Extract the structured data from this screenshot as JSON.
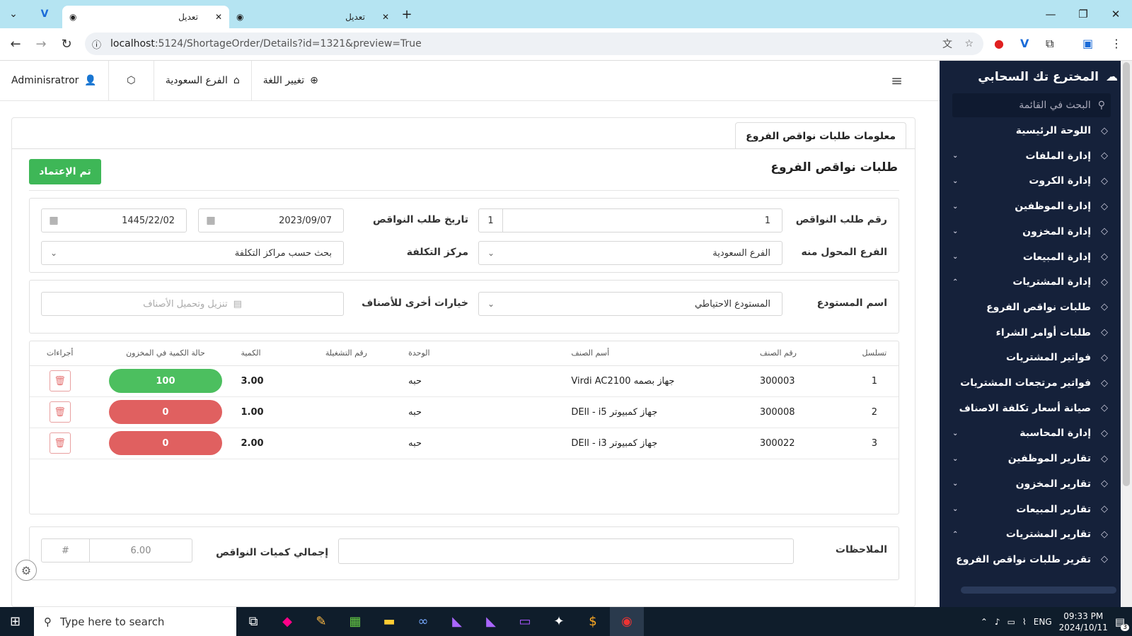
{
  "browser": {
    "tabs": [
      {
        "title": "تعديل",
        "active": true
      },
      {
        "title": "تعديل",
        "active": false
      }
    ],
    "url_host": "localhost",
    "url_rest": ":5124/ShortageOrder/Details?id=1321&preview=True"
  },
  "topnav": {
    "user": "Adminisratror",
    "branch": "الفرع السعودية",
    "language": "تغيير اللغة"
  },
  "card": {
    "tab_label": "معلومات طلبات نواقص الفروع",
    "page_title": "طلبات نواقص الفروع",
    "approve_label": "تم الإعتماد"
  },
  "form": {
    "order_number_label": "رقم طلب النواقص",
    "order_number_value": "1",
    "order_number_small": "1",
    "order_date_label": "تاريخ طلب النواقص",
    "order_date_value": "2023/09/07",
    "hijri_date_value": "1445/22/02",
    "from_branch_label": "الفرع المحول منه",
    "from_branch_value": "الفرع السعودية",
    "cost_center_label": "مركز التكلفة",
    "cost_center_value": "بحث حسب مراكز التكلفة",
    "warehouse_label": "اسم المستودع",
    "warehouse_value": "المستودع الاحتياطي",
    "other_options_label": "خيارات أخرى للأصناف",
    "download_placeholder": "تنزيل وتحميل الأصناف"
  },
  "table": {
    "headers": {
      "seq": "تسلسل",
      "item_no": "رقم الصنف",
      "item_name": "أسم الصنف",
      "unit": "الوحدة",
      "batch": "رقم التشغيلة",
      "qty": "الكمية",
      "stock_status": "حالة الكمية في المخزون",
      "actions": "أجراءات"
    },
    "rows": [
      {
        "seq": "1",
        "item_no": "300003",
        "item_name": "جهاز بصمه Virdi AC2100",
        "unit": "حبه",
        "batch": "",
        "qty": "3.00",
        "stock": "100",
        "stock_color": "#4cbf5f"
      },
      {
        "seq": "2",
        "item_no": "300008",
        "item_name": "جهاز كمبيوتر DEll - i5",
        "unit": "حبه",
        "batch": "",
        "qty": "1.00",
        "stock": "0",
        "stock_color": "#e06060"
      },
      {
        "seq": "3",
        "item_no": "300022",
        "item_name": "جهاز كمبيوتر DEll - i3",
        "unit": "حبه",
        "batch": "",
        "qty": "2.00",
        "stock": "0",
        "stock_color": "#e06060"
      }
    ]
  },
  "footer": {
    "notes_label": "الملاحظات",
    "total_label": "إجمالي كميات النواقص",
    "total_value": "6.00",
    "hash": "#"
  },
  "sidebar": {
    "brand": "المخترع تك السحابي",
    "search_placeholder": "البحث في القائمة",
    "items": [
      {
        "label": "اللوحة الرئيسية",
        "icon": "home-icon",
        "arrow": ""
      },
      {
        "label": "إدارة الملفات",
        "icon": "file-icon",
        "arrow": "⌄"
      },
      {
        "label": "إدارة الكروت",
        "icon": "tag-icon",
        "arrow": "⌄"
      },
      {
        "label": "إدارة الموظفين",
        "icon": "fingerprint-icon",
        "arrow": "⌄"
      },
      {
        "label": "إدارة المخزون",
        "icon": "box-icon",
        "arrow": "⌄"
      },
      {
        "label": "إدارة المبيعات",
        "icon": "cart-icon",
        "arrow": "⌄"
      },
      {
        "label": "إدارة المشتريات",
        "icon": "basket-icon",
        "arrow": "⌃"
      },
      {
        "label": "طلبات نواقص الفروع",
        "icon": "basket-icon",
        "arrow": "",
        "sub": true
      },
      {
        "label": "طلبات أوامر الشراء",
        "icon": "basket-icon",
        "arrow": "",
        "sub": true
      },
      {
        "label": "فواتير المشتريات",
        "icon": "basket-plus-icon",
        "arrow": "",
        "sub": true
      },
      {
        "label": "فواتير مرتجعات المشتريات",
        "icon": "basket-return-icon",
        "arrow": "",
        "sub": true
      },
      {
        "label": "صيانة أسعار تكلفة الاصناف",
        "icon": "bag-search-icon",
        "arrow": "",
        "sub": true
      },
      {
        "label": "إدارة المحاسبة",
        "icon": "dollar-icon",
        "arrow": "⌄"
      },
      {
        "label": "تقارير الموظفين",
        "icon": "user-search-icon",
        "arrow": "⌄"
      },
      {
        "label": "تقارير المخزون",
        "icon": "report-box-icon",
        "arrow": "⌄"
      },
      {
        "label": "تقارير المبيعات",
        "icon": "report-cart-icon",
        "arrow": "⌄"
      },
      {
        "label": "تقارير المشتريات",
        "icon": "report-basket-icon",
        "arrow": "⌃"
      },
      {
        "label": "تقرير طلبات نواقص الفروع",
        "icon": "report-file-icon",
        "arrow": "",
        "sub": true
      }
    ]
  },
  "taskbar": {
    "search_placeholder": "Type here to search",
    "lang": "ENG",
    "time": "09:33 PM",
    "date": "2024/10/11",
    "notif_count": "3"
  }
}
